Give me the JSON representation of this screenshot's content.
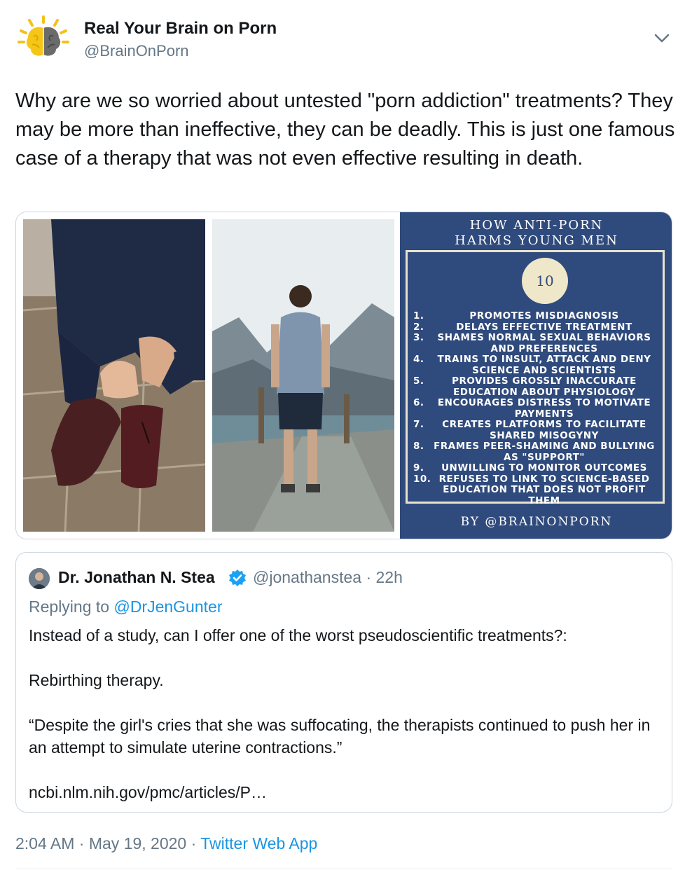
{
  "author": {
    "name": "Real Your Brain on Porn",
    "handle": "@BrainOnPorn"
  },
  "tweet": {
    "text": "Why are we so worried about untested \"porn addiction\" treatments? They may be more than ineffective, they can be deadly. This is just one famous case of a therapy that was not even effective resulting in death."
  },
  "infographic": {
    "title_line1": "HOW ANTI-PORN",
    "title_line2": "HARMS YOUNG MEN",
    "count": "10",
    "items": [
      {
        "num": "1.",
        "text": "PROMOTES MISDIAGNOSIS"
      },
      {
        "num": "2.",
        "text": "DELAYS EFFECTIVE TREATMENT"
      },
      {
        "num": "3.",
        "text": "SHAMES NORMAL SEXUAL BEHAVIORS AND PREFERENCES"
      },
      {
        "num": "4.",
        "text": "TRAINS TO INSULT, ATTACK AND DENY SCIENCE AND SCIENTISTS"
      },
      {
        "num": "5.",
        "text": "PROVIDES GROSSLY INACCURATE EDUCATION ABOUT PHYSIOLOGY"
      },
      {
        "num": "6.",
        "text": "ENCOURAGES DISTRESS TO MOTIVATE PAYMENTS"
      },
      {
        "num": "7.",
        "text": "CREATES PLATFORMS TO FACILITATE SHARED MISOGYNY"
      },
      {
        "num": "8.",
        "text": "FRAMES PEER-SHAMING AND BULLYING AS \"SUPPORT\""
      },
      {
        "num": "9.",
        "text": "UNWILLING TO MONITOR OUTCOMES"
      },
      {
        "num": "10.",
        "text": "REFUSES TO LINK TO SCIENCE-BASED EDUCATION THAT DOES NOT PROFIT THEM"
      }
    ],
    "byline": "BY @BRAINONPORN"
  },
  "quote": {
    "name": "Dr. Jonathan N. Stea",
    "meta": "@jonathanstea · 22h",
    "replying_prefix": "Replying to ",
    "replying_to": "@DrJenGunter",
    "paragraphs": [
      "Instead of a study, can I offer one of the worst pseudoscientific treatments?:",
      "Rebirthing therapy.",
      "“Despite the girl's cries that she was suffocating, the therapists continued to push her in an attempt to simulate uterine contractions.”",
      "ncbi.nlm.nih.gov/pmc/articles/P…"
    ]
  },
  "footer": {
    "time": "2:04 AM",
    "sep1": " · ",
    "date": "May 19, 2020",
    "sep2": " · ",
    "app": "Twitter Web App"
  },
  "colors": {
    "link": "#1b95e0",
    "secondary_text": "#657786",
    "infographic_bg": "#2f4a7c",
    "verified": "#1da1f2"
  },
  "icons": [
    "brain-logo-icon",
    "chevron-down-icon",
    "verified-badge-icon"
  ]
}
